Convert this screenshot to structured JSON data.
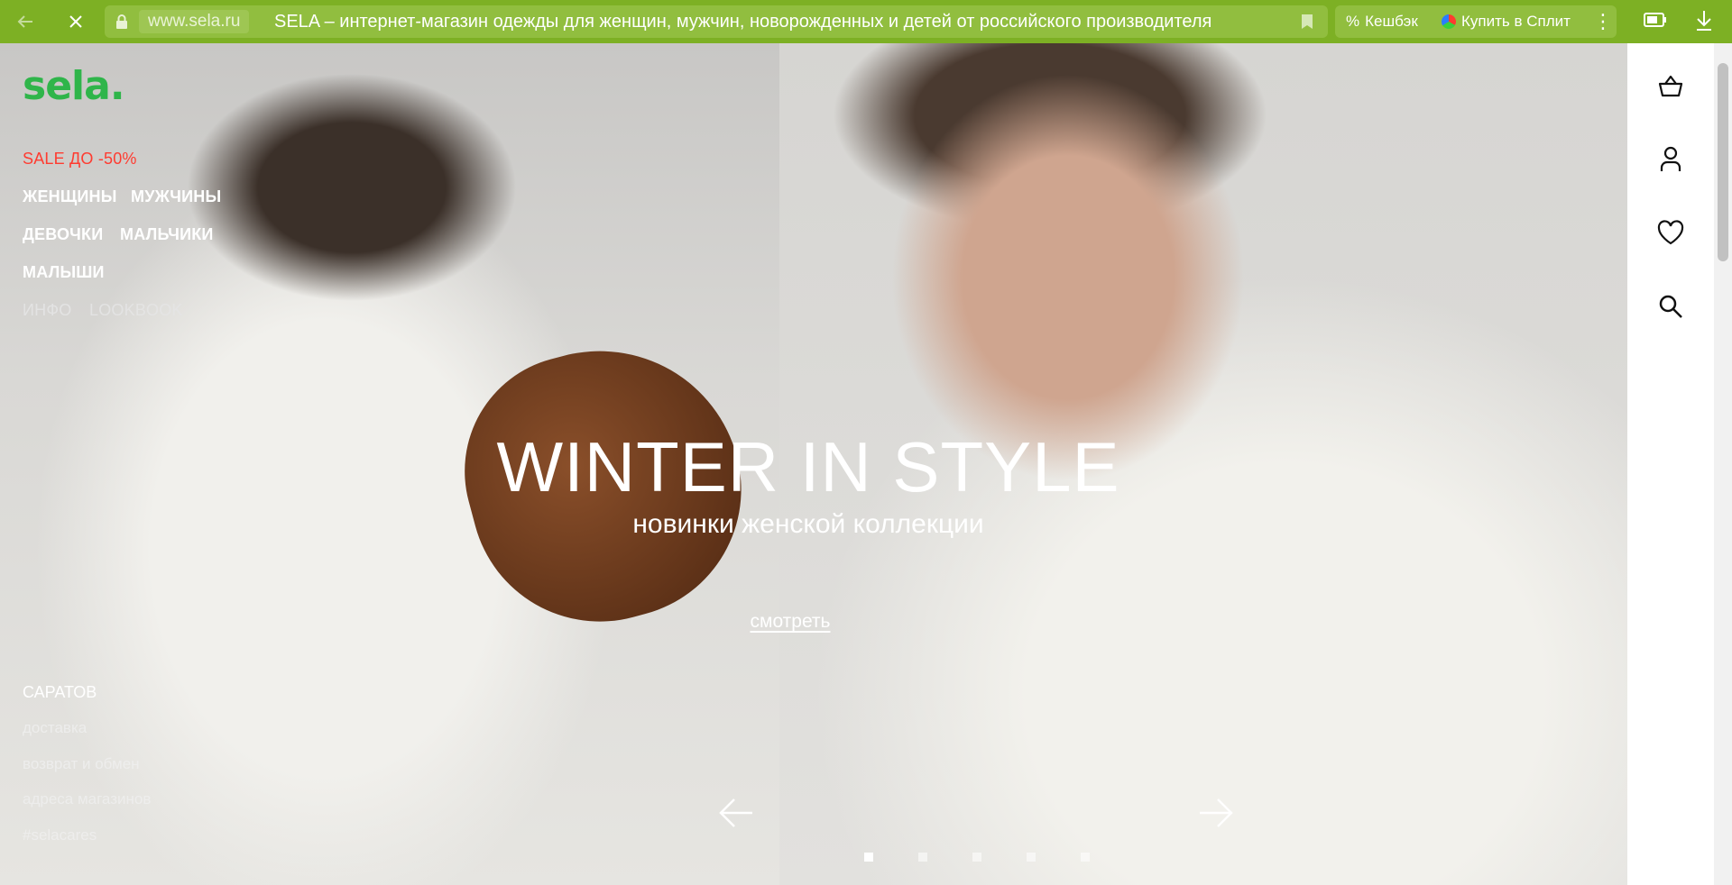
{
  "browser": {
    "domain": "www.sela.ru",
    "title": "SELA – интернет-магазин одежды для женщин, мужчин, новорожденных и детей от российского производителя",
    "extensions": [
      {
        "label": "Кешбэк",
        "icon": "percent-icon"
      },
      {
        "label": "Купить в Сплит",
        "icon": "split-icon"
      }
    ]
  },
  "site": {
    "logo": "sela",
    "menu": {
      "sale": "SALE ДО -50%",
      "women": "ЖЕНЩИНЫ",
      "men": "МУЖЧИНЫ",
      "girls": "ДЕВОЧКИ",
      "boys": "МАЛЬЧИКИ",
      "babies": "МАЛЫШИ",
      "info": "ИНФО",
      "lookbook": "LOOKBOOK"
    },
    "footer": {
      "city": "САРАТОВ",
      "links": [
        "доставка",
        "возврат и обмен",
        "адреса магазинов",
        "#selacares"
      ]
    }
  },
  "hero": {
    "headline": "WINTER IN STYLE",
    "subhead": "новинки женской коллекции",
    "cta": "смотреть",
    "slides_total": 5,
    "active_slide": 1
  },
  "rail": {
    "icons": [
      "cart-icon",
      "user-icon",
      "heart-icon",
      "search-icon"
    ]
  },
  "colors": {
    "browser_bar": "#7db024",
    "logo": "#2fb54a",
    "sale": "#ff3b30"
  }
}
